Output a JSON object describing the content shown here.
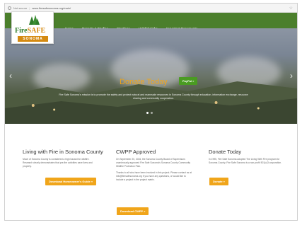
{
  "browser": {
    "status": "Not secure",
    "url": "www.firesafesonoma.org/main/"
  },
  "logo": {
    "fire": "Fire",
    "safe": "SAFE",
    "sonoma": "SONOMA"
  },
  "nav": {
    "items": [
      "Home",
      "Reports & Studies",
      "Meetings",
      "Helpful Links",
      "Important Documents"
    ]
  },
  "hero": {
    "title": "Donate Today",
    "paypal_label": "PayPal »",
    "mission": "Fire Safe Sonoma's mission is to promote the safety and protect natural and manmade resources in Sonoma County through education, information exchange, resource sharing and community cooperation.",
    "prev_arrow": "‹",
    "next_arrow": "›"
  },
  "columns": [
    {
      "title": "Living with Fire in Sonoma County",
      "text": "Much of Sonoma County is considered a high hazard for wildfire. Research clearly demonstrates that pre-fire activities save lives and property.",
      "button": "Download Homeowner's Guide »"
    },
    {
      "title": "CWPP Approved",
      "text": "On September 20, 2016, the Sonoma County Board of Supervisors unanimously approved Fire Safe Sonoma's Sonoma County Community Wildfire Protection Plan.",
      "text2": "Thanks to all who have been involved in this project. Please contact us at info@firesafesonoma.org if you have any questions, or would like to include a project in the project matrix.",
      "button": "Download CWPP »"
    },
    {
      "title": "Donate Today",
      "text": "In 1995, Fire Safe Sonoma adopted The Living With Fire program for Sonoma County. Fire Safe Sonoma is a non-profit 501(c)3 corporation.",
      "button": "Donate »"
    }
  ],
  "colors": {
    "header_green": "#4b7f2c",
    "accent_orange": "#f0a51a",
    "paypal_green": "#4a9b22"
  }
}
